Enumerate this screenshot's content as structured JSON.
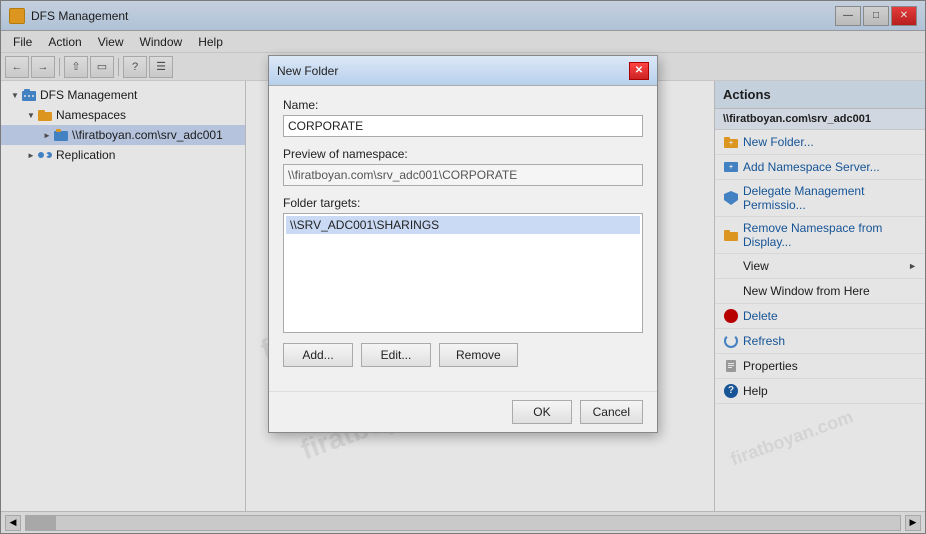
{
  "window": {
    "title": "DFS Management",
    "icon": "dfs-icon",
    "controls": {
      "minimize": "—",
      "maximize": "□",
      "close": "✕"
    }
  },
  "menubar": {
    "items": [
      "File",
      "Action",
      "View",
      "Window",
      "Help"
    ]
  },
  "toolbar": {
    "buttons": [
      "←",
      "→",
      "⬆",
      "🔲",
      "?",
      "📋"
    ]
  },
  "tree": {
    "items": [
      {
        "label": "DFS Management",
        "level": 0,
        "expanded": true
      },
      {
        "label": "Namespaces",
        "level": 1,
        "expanded": true
      },
      {
        "label": "\\\\firatboyan.com\\srv_adc001",
        "level": 2,
        "selected": true
      },
      {
        "label": "Replication",
        "level": 1,
        "expanded": false
      }
    ]
  },
  "actions_panel": {
    "header": "Actions",
    "section_title": "\\\\firatboyan.com\\srv_adc001",
    "items": [
      {
        "label": "New Folder...",
        "icon": "folder-icon",
        "type": "link"
      },
      {
        "label": "Add Namespace Server...",
        "icon": "server-icon",
        "type": "link"
      },
      {
        "label": "Delegate Management Permissio...",
        "icon": "shield-icon",
        "type": "link"
      },
      {
        "label": "Remove Namespace from Display...",
        "icon": "remove-icon",
        "type": "link"
      },
      {
        "label": "View",
        "icon": "",
        "type": "plain",
        "hasSubmenu": true
      },
      {
        "label": "New Window from Here",
        "icon": "",
        "type": "plain"
      },
      {
        "label": "Delete",
        "icon": "delete-icon",
        "type": "link"
      },
      {
        "label": "Refresh",
        "icon": "refresh-icon",
        "type": "link"
      },
      {
        "label": "Properties",
        "icon": "properties-icon",
        "type": "plain"
      },
      {
        "label": "Help",
        "icon": "help-icon",
        "type": "plain"
      }
    ]
  },
  "dialog": {
    "title": "New Folder",
    "name_label": "Name:",
    "name_value": "CORPORATE",
    "preview_label": "Preview of namespace:",
    "preview_value": "\\\\firatboyan.com\\srv_adc001\\CORPORATE",
    "targets_label": "Folder targets:",
    "targets": [
      "\\\\SRV_ADC001\\SHARINGS"
    ],
    "buttons": {
      "add": "Add...",
      "edit": "Edit...",
      "remove": "Remove"
    },
    "footer": {
      "ok": "OK",
      "cancel": "Cancel"
    }
  },
  "watermark": "firatboyan.com"
}
